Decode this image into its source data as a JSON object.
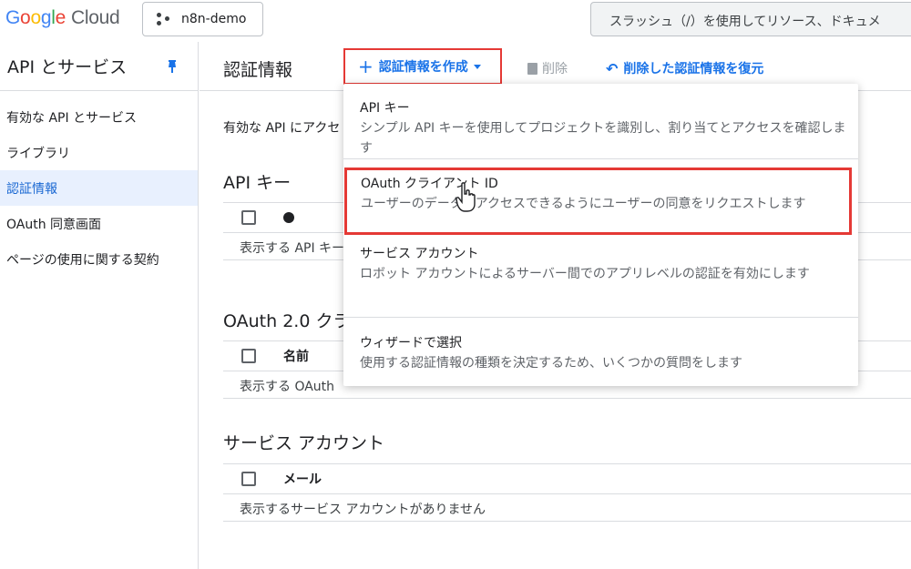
{
  "header": {
    "logo": {
      "g1": "G",
      "g2": "o",
      "g3": "o",
      "g4": "g",
      "g5": "l",
      "g6": "e",
      "cloud": "Cloud"
    },
    "project": "n8n-demo",
    "search_text": "スラッシュ（/）を使用してリソース、ドキュメ"
  },
  "sidebar": {
    "title": "API とサービス",
    "items": [
      {
        "label": "有効な API とサービス",
        "active": false
      },
      {
        "label": "ライブラリ",
        "active": false
      },
      {
        "label": "認証情報",
        "active": true
      },
      {
        "label": "OAuth 同意画面",
        "active": false
      },
      {
        "label": "ページの使用に関する契約",
        "active": false
      }
    ]
  },
  "toolbar": {
    "title": "認証情報",
    "create_label": "認証情報を作成",
    "delete_label": "削除",
    "restore_label": "削除した認証情報を復元"
  },
  "main": {
    "intro": "有効な API にアクセ",
    "api_keys": {
      "title": "API キー",
      "empty": "表示する API キー"
    },
    "oauth": {
      "title": "OAuth 2.0 クラ",
      "col_name": "名前",
      "empty": "表示する OAuth"
    },
    "service_accounts": {
      "title": "サービス アカウント",
      "col_mail": "メール",
      "empty": "表示するサービス アカウントがありません"
    }
  },
  "menu": {
    "items": [
      {
        "title": "API キー",
        "desc": "シンプル API キーを使用してプロジェクトを識別し、割り当てとアクセスを確認します"
      },
      {
        "title": "OAuth クライアント ID",
        "desc": "ユーザーのデータにアクセスできるようにユーザーの同意をリクエストします"
      },
      {
        "title": "サービス アカウント",
        "desc": "ロボット アカウントによるサーバー間でのアプリレベルの認証を有効にします"
      },
      {
        "title": "ウィザードで選択",
        "desc": "使用する認証情報の種類を決定するため、いくつかの質問をします"
      }
    ]
  },
  "colors": {
    "accent": "#1a73e8",
    "highlight": "#e53935",
    "active_bg": "#e8f0fe"
  }
}
